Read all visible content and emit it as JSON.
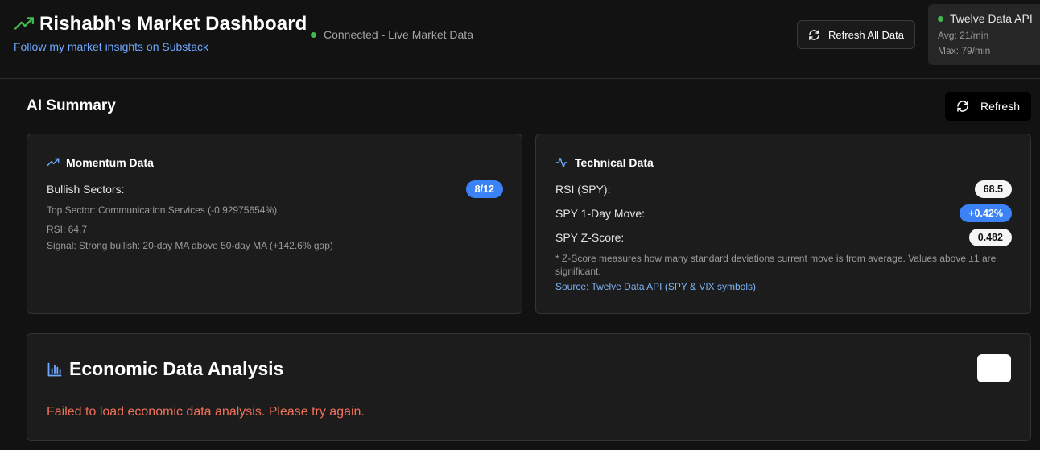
{
  "header": {
    "title": "Rishabh's Market Dashboard",
    "substack_link": "Follow my market insights on Substack",
    "connection_status": "Connected - Live Market Data",
    "refresh_all_label": "Refresh All Data",
    "api": {
      "name": "Twelve Data API",
      "avg": "Avg: 21/min",
      "max": "Max: 79/min"
    }
  },
  "ai_summary": {
    "title": "AI Summary",
    "refresh_label": "Refresh",
    "momentum": {
      "title": "Momentum Data",
      "bullish_label": "Bullish Sectors:",
      "bullish_value": "8/12",
      "top_sector": "Top Sector: Communication Services (-0.92975654%)",
      "rsi": "RSI: 64.7",
      "signal": "Signal: Strong bullish: 20-day MA above 50-day MA (+142.6% gap)"
    },
    "technical": {
      "title": "Technical Data",
      "rsi_label": "RSI (SPY):",
      "rsi_value": "68.5",
      "move_label": "SPY 1-Day Move:",
      "move_value": "+0.42%",
      "z_label": "SPY Z-Score:",
      "z_value": "0.482",
      "footnote": "* Z-Score measures how many standard deviations current move is from average. Values above ±1 are significant.",
      "source": "Source: Twelve Data API (SPY & VIX symbols)"
    }
  },
  "economic": {
    "title": "Economic Data Analysis",
    "error": "Failed to load economic data analysis. Please try again."
  },
  "colors": {
    "background": "#121212",
    "accent_blue": "#3b82f6",
    "status_green": "#3fb950",
    "error_red": "#f0705a"
  },
  "icons": {
    "brand": "trending-up-icon",
    "refresh": "refresh-icon",
    "momentum": "trending-up-icon",
    "technical": "activity-icon",
    "economic": "bar-chart-icon"
  }
}
